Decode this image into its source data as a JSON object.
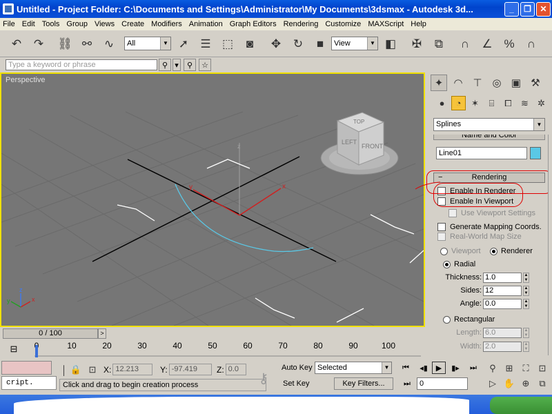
{
  "window": {
    "title": "Untitled      - Project Folder: C:\\Documents and Settings\\Administrator\\My Documents\\3dsmax      - Autodesk 3d...",
    "minimize": "_",
    "restore": "❐",
    "close": "✕"
  },
  "menu": [
    "File",
    "Edit",
    "Tools",
    "Group",
    "Views",
    "Create",
    "Modifiers",
    "Animation",
    "Graph Editors",
    "Rendering",
    "Customize",
    "MAXScript",
    "Help"
  ],
  "toolbar": {
    "selection_filter": "All",
    "reference_coord": "View"
  },
  "search": {
    "placeholder": "Type a keyword or phrase"
  },
  "viewport": {
    "label": "Perspective",
    "viewcube": {
      "top": "TOP",
      "left": "LEFT",
      "front": "FRONT"
    },
    "axis_labels": {
      "x": "x",
      "y": "y",
      "z": "z"
    }
  },
  "command_panel": {
    "category": "Splines",
    "name_color_title": "Name and Color",
    "object_name": "Line01",
    "object_color": "#5ac8e6",
    "rendering": {
      "title": "Rendering",
      "toggle": "−",
      "enable_in_renderer": "Enable In Renderer",
      "enable_in_viewport": "Enable In Viewport",
      "use_viewport_settings": "Use Viewport Settings",
      "generate_mapping": "Generate Mapping Coords.",
      "real_world_map": "Real-World Map Size",
      "viewport_radio": "Viewport",
      "renderer_radio": "Renderer",
      "radial": "Radial",
      "thickness_label": "Thickness:",
      "thickness": "1.0",
      "sides_label": "Sides:",
      "sides": "12",
      "angle_label": "Angle:",
      "angle": "0.0",
      "rectangular": "Rectangular",
      "length_label": "Length:",
      "length": "6.0",
      "width_label": "Width:",
      "width": "2.0"
    }
  },
  "time_slider": {
    "frame_display": "0 / 100",
    "next": ">"
  },
  "track_bar": {
    "ticks": [
      "0",
      "10",
      "20",
      "30",
      "40",
      "50",
      "60",
      "70",
      "80",
      "90",
      "100"
    ]
  },
  "status": {
    "script_text": "cript.",
    "x_label": "X:",
    "x_value": "12.213",
    "y_label": "Y:",
    "y_value": "-97.419",
    "z_label": "Z:",
    "z_value": "0.0",
    "prompt": "Click and drag to begin creation process",
    "auto_key": "Auto Key",
    "set_key": "Set Key",
    "key_mode": "Selected",
    "key_filters": "Key Filters...",
    "current_frame": "0"
  },
  "colors": {
    "viewport_bg": "#767676",
    "active_border": "#f0e000",
    "spline": "#5ac8e6",
    "annotation": "#e00000"
  }
}
